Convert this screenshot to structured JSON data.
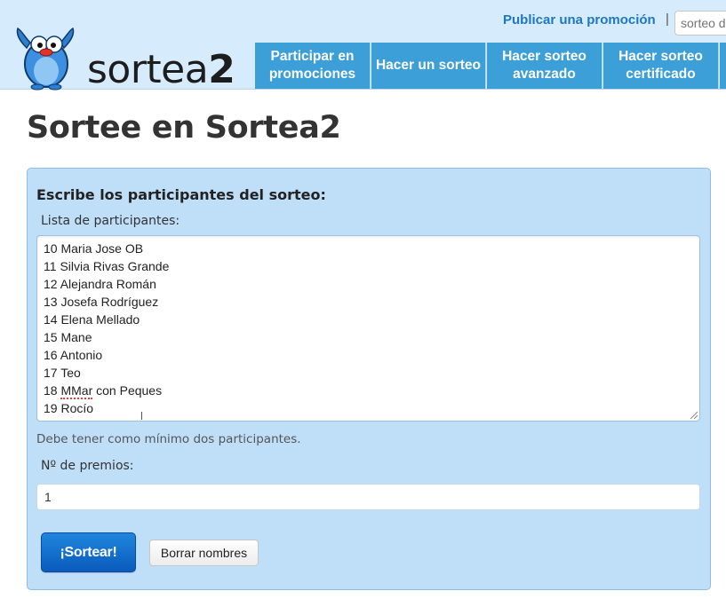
{
  "header": {
    "logo_text_main": "sortea",
    "logo_text_accent": "2",
    "top_link": "Publicar una promoción",
    "separator": "|",
    "search_placeholder": "sorteo d",
    "nav": [
      {
        "label": "Participar en promociones"
      },
      {
        "label": "Hacer un sorteo"
      },
      {
        "label": "Hacer sorteo avanzado"
      },
      {
        "label": "Hacer sorteo certificado"
      }
    ]
  },
  "page": {
    "title": "Sortee en Sortea2"
  },
  "form": {
    "heading": "Escribe los participantes del sorteo:",
    "participants_label": "Lista de participantes:",
    "participants": [
      {
        "number": "10",
        "name": "Maria Jose OB"
      },
      {
        "number": "11",
        "name": "Silvia Rivas Grande"
      },
      {
        "number": "12",
        "name": "Alejandra Román"
      },
      {
        "number": "13",
        "name": "Josefa Rodríguez"
      },
      {
        "number": "14",
        "name": "Elena Mellado"
      },
      {
        "number": "15",
        "name": "Mane"
      },
      {
        "number": "16",
        "name": "Antonio"
      },
      {
        "number": "17",
        "name": "Teo"
      },
      {
        "number": "18",
        "name_misspelled": "MMar",
        "name_rest": " con Peques"
      },
      {
        "number": "19",
        "name": "Rocío"
      }
    ],
    "helper_text": "Debe tener como mínimo dos participantes.",
    "prizes_label": "Nº de premios:",
    "prizes_value": "1",
    "submit_label": "¡Sortear!",
    "clear_label": "Borrar nombres"
  },
  "colors": {
    "header_bg": "#d6ebfb",
    "nav_bg": "#3c9fd8",
    "link": "#1d78c1",
    "panel_bg": "#bfdff9",
    "primary_button": "#0a5bbd"
  }
}
